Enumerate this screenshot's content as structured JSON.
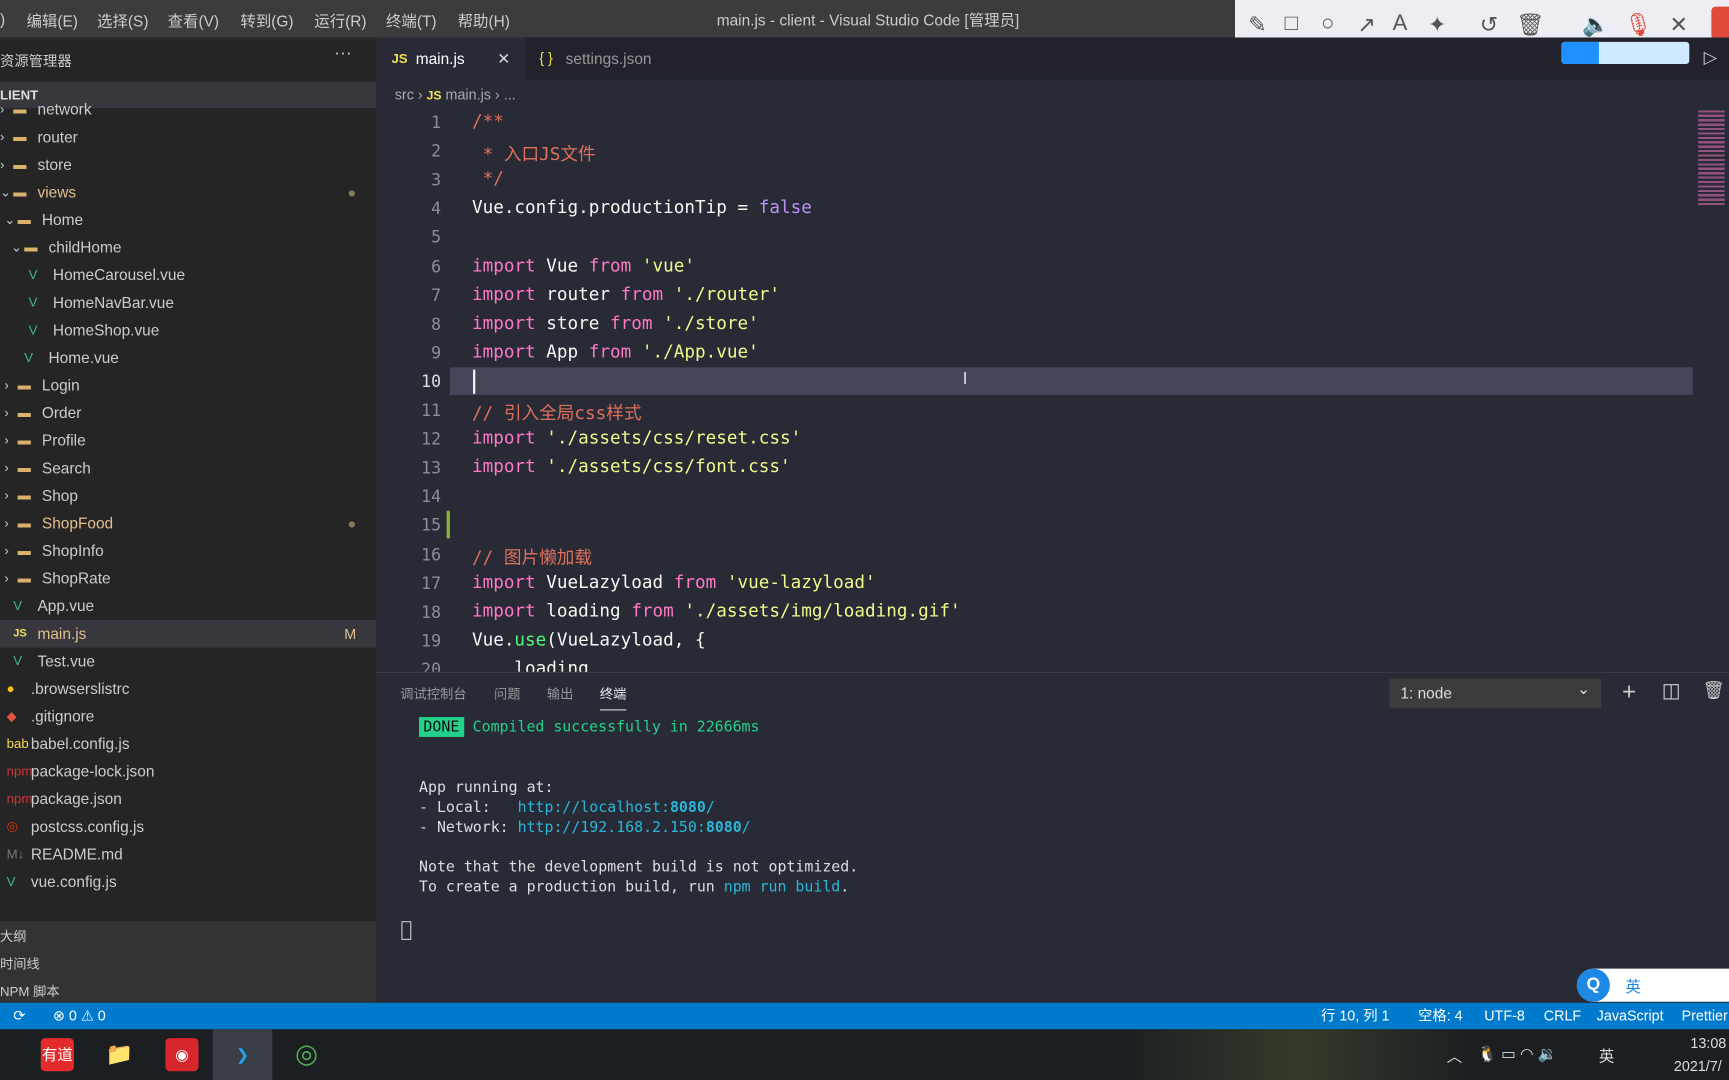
{
  "menubar": {
    "items": [
      "编辑(E)",
      "选择(S)",
      "查看(V)",
      "转到(G)",
      "运行(R)",
      "终端(T)",
      "帮助(H)"
    ],
    "title": "main.js - client - Visual Studio Code [管理员]"
  },
  "recorder_toolbar": {
    "icons": [
      "pencil-icon",
      "rectangle-icon",
      "circle-icon",
      "arrow-icon",
      "text-icon",
      "magic-wand-icon",
      "undo-icon",
      "trash-icon",
      "speaker-icon",
      "mic-muted-icon",
      "close-icon"
    ],
    "glyphs": [
      "✎",
      "□",
      "○",
      "↗",
      "A",
      "✦",
      "↺",
      "🗑",
      "🔈",
      "🎙",
      "✕"
    ]
  },
  "sidebar": {
    "title": "资源管理器",
    "more": "···",
    "root": "LIENT",
    "items": [
      {
        "label": "network",
        "type": "folder",
        "indent": 0
      },
      {
        "label": "router",
        "type": "folder",
        "indent": 0
      },
      {
        "label": "store",
        "type": "folder",
        "indent": 0
      },
      {
        "label": "views",
        "type": "folder-open",
        "indent": 0,
        "badge": "●",
        "color": "#e2c08d"
      },
      {
        "label": "Home",
        "type": "folder-open",
        "indent": 1
      },
      {
        "label": "childHome",
        "type": "folder-open",
        "indent": 2
      },
      {
        "label": "HomeCarousel.vue",
        "type": "vue",
        "indent": 3
      },
      {
        "label": "HomeNavBar.vue",
        "type": "vue",
        "indent": 3
      },
      {
        "label": "HomeShop.vue",
        "type": "vue",
        "indent": 3
      },
      {
        "label": "Home.vue",
        "type": "vue",
        "indent": 2
      },
      {
        "label": "Login",
        "type": "folder",
        "indent": 1
      },
      {
        "label": "Order",
        "type": "folder",
        "indent": 1
      },
      {
        "label": "Profile",
        "type": "folder",
        "indent": 1
      },
      {
        "label": "Search",
        "type": "folder",
        "indent": 1
      },
      {
        "label": "Shop",
        "type": "folder",
        "indent": 1
      },
      {
        "label": "ShopFood",
        "type": "folder",
        "indent": 1,
        "badge": "●",
        "color": "#e2c08d"
      },
      {
        "label": "ShopInfo",
        "type": "folder",
        "indent": 1
      },
      {
        "label": "ShopRate",
        "type": "folder",
        "indent": 1
      },
      {
        "label": "App.vue",
        "type": "vue",
        "indent": 0
      },
      {
        "label": "main.js",
        "type": "js",
        "indent": 0,
        "badge": "M",
        "color": "#e2c08d",
        "selected": true
      },
      {
        "label": "Test.vue",
        "type": "vue",
        "indent": 0
      },
      {
        "label": ".browserslistrc",
        "type": "browserslist",
        "indent": -1
      },
      {
        "label": ".gitignore",
        "type": "git",
        "indent": -1
      },
      {
        "label": "babel.config.js",
        "type": "babel",
        "indent": -1
      },
      {
        "label": "package-lock.json",
        "type": "npm",
        "indent": -1
      },
      {
        "label": "package.json",
        "type": "npm",
        "indent": -1
      },
      {
        "label": "postcss.config.js",
        "type": "postcss",
        "indent": -1
      },
      {
        "label": "README.md",
        "type": "md",
        "indent": -1
      },
      {
        "label": "vue.config.js",
        "type": "vue",
        "indent": -1
      }
    ],
    "bottom": [
      "大纲",
      "时间线",
      "NPM 脚本"
    ]
  },
  "tabs": [
    {
      "label": "main.js",
      "icon": "JS",
      "active": true,
      "close": "✕"
    },
    {
      "label": "settings.json",
      "icon": "{ }",
      "active": false
    }
  ],
  "breadcrumb": {
    "parts": [
      "src",
      "main.js",
      "..."
    ],
    "js": "JS",
    "sep": "›"
  },
  "colors": {
    "keyword": "#ff79c6",
    "string": "#f1fa8c",
    "comment": "#e0715c",
    "bool": "#bd93f9",
    "func": "#50fa7b",
    "plain": "#f8f8f2",
    "accent": "#007acc"
  },
  "code": [
    [
      [
        "/**",
        "comment"
      ]
    ],
    [
      [
        " * 入口JS文件",
        "comment"
      ]
    ],
    [
      [
        " */",
        "comment"
      ]
    ],
    [
      [
        "Vue.config.productionTip = ",
        "plain"
      ],
      [
        "false",
        "bool"
      ]
    ],
    [],
    [
      [
        "import",
        "keyword"
      ],
      [
        " Vue ",
        "plain"
      ],
      [
        "from",
        "keyword"
      ],
      [
        " 'vue'",
        "string"
      ]
    ],
    [
      [
        "import",
        "keyword"
      ],
      [
        " router ",
        "plain"
      ],
      [
        "from",
        "keyword"
      ],
      [
        " './router'",
        "string"
      ]
    ],
    [
      [
        "import",
        "keyword"
      ],
      [
        " store ",
        "plain"
      ],
      [
        "from",
        "keyword"
      ],
      [
        " './store'",
        "string"
      ]
    ],
    [
      [
        "import",
        "keyword"
      ],
      [
        " App ",
        "plain"
      ],
      [
        "from",
        "keyword"
      ],
      [
        " './App.vue'",
        "string"
      ]
    ],
    [],
    [
      [
        "// 引入全局css样式",
        "comment"
      ]
    ],
    [
      [
        "import",
        "keyword"
      ],
      [
        " './assets/css/reset.css'",
        "string"
      ]
    ],
    [
      [
        "import",
        "keyword"
      ],
      [
        " './assets/css/font.css'",
        "string"
      ]
    ],
    [],
    [],
    [
      [
        "// 图片懒加载",
        "comment"
      ]
    ],
    [
      [
        "import",
        "keyword"
      ],
      [
        " VueLazyload ",
        "plain"
      ],
      [
        "from",
        "keyword"
      ],
      [
        " 'vue-lazyload'",
        "string"
      ]
    ],
    [
      [
        "import",
        "keyword"
      ],
      [
        " loading ",
        "plain"
      ],
      [
        "from",
        "keyword"
      ],
      [
        " './assets/img/loading.gif'",
        "string"
      ]
    ],
    [
      [
        "Vue.",
        "plain"
      ],
      [
        "use",
        "func"
      ],
      [
        "(VueLazyload, {",
        "plain"
      ]
    ],
    [
      [
        "    loading",
        "plain"
      ]
    ]
  ],
  "panel": {
    "tabs": [
      "调试控制台",
      "问题",
      "输出",
      "终端"
    ],
    "active": 3,
    "terminal_select": "1: node",
    "chevron": "⌄",
    "actions": [
      "+",
      "◫",
      "🗑"
    ]
  },
  "terminal": {
    "done": "DONE",
    "compiled": "Compiled successfully in 22666ms",
    "app_running": "App running at:",
    "local_label": "- Local:   ",
    "local_url": "http://localhost:",
    "local_port": "8080",
    "slash": "/",
    "network_label": "- Network: ",
    "network_url": "http://192.168.2.150:",
    "network_port": "8080",
    "note1": "Note that the development build is not optimized.",
    "note2_pre": "To create a production build, run ",
    "note2_cmd": "npm run build",
    "note2_post": "."
  },
  "statusbar": {
    "sync": "⟳",
    "errors": "⊗ 0 ⚠ 0",
    "position": "行 10, 列 1",
    "spaces": "空格: 4",
    "encoding": "UTF-8",
    "eol": "CRLF",
    "language": "JavaScript",
    "formatter": "Prettier"
  },
  "ime": {
    "lang": "英"
  },
  "taskbar": {
    "apps": [
      {
        "name": "youdao",
        "label": "有道",
        "color": "#e32b2b"
      },
      {
        "name": "file-explorer",
        "label": "📁",
        "color": "transparent"
      },
      {
        "name": "netease-music",
        "label": "◉",
        "color": "#d7262c"
      },
      {
        "name": "vscode",
        "label": "❯",
        "color": "#3a3f45"
      },
      {
        "name": "chrome",
        "label": "◎",
        "color": "transparent"
      }
    ],
    "tray_lang": "英",
    "time": "13:08",
    "date": "2021/7/"
  }
}
